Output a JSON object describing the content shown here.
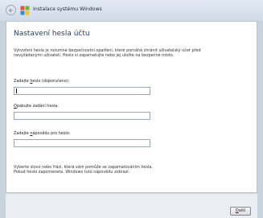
{
  "window": {
    "title": "Instalace systému Windows"
  },
  "page": {
    "heading": "Nastavení hesla účtu",
    "intro_line1": "Vytvoření hesla je rozumné bezpečnostní opatření, které pomáhá chránit uživatelský účet před",
    "intro_line2": "nevyžádanými uživateli. Heslo si zapamatujte nebo jej uložte na bezpečné místo."
  },
  "fields": {
    "password": {
      "label_pre": "Zadejte ",
      "label_key": "h",
      "label_post": "eslo (doporučeno):",
      "value": ""
    },
    "confirm": {
      "label_pre": "",
      "label_key": "O",
      "label_post": "pakujte zadání hesla:",
      "value": ""
    },
    "hint": {
      "label_pre": "Zadejte ",
      "label_key": "n",
      "label_post": "ápovědu pro heslo:",
      "value": ""
    }
  },
  "hint_text": {
    "line1": "Vyberte slovo nebo frázi, která vám pomůže se zapamatováním hesla.",
    "line2": "Pokud heslo zapomenete, Windows tuto nápovědu zobrazí."
  },
  "buttons": {
    "next_key": "D",
    "next_rest": "alší"
  },
  "icons": {
    "back": "back-arrow-icon",
    "logo": "windows-logo-icon"
  }
}
